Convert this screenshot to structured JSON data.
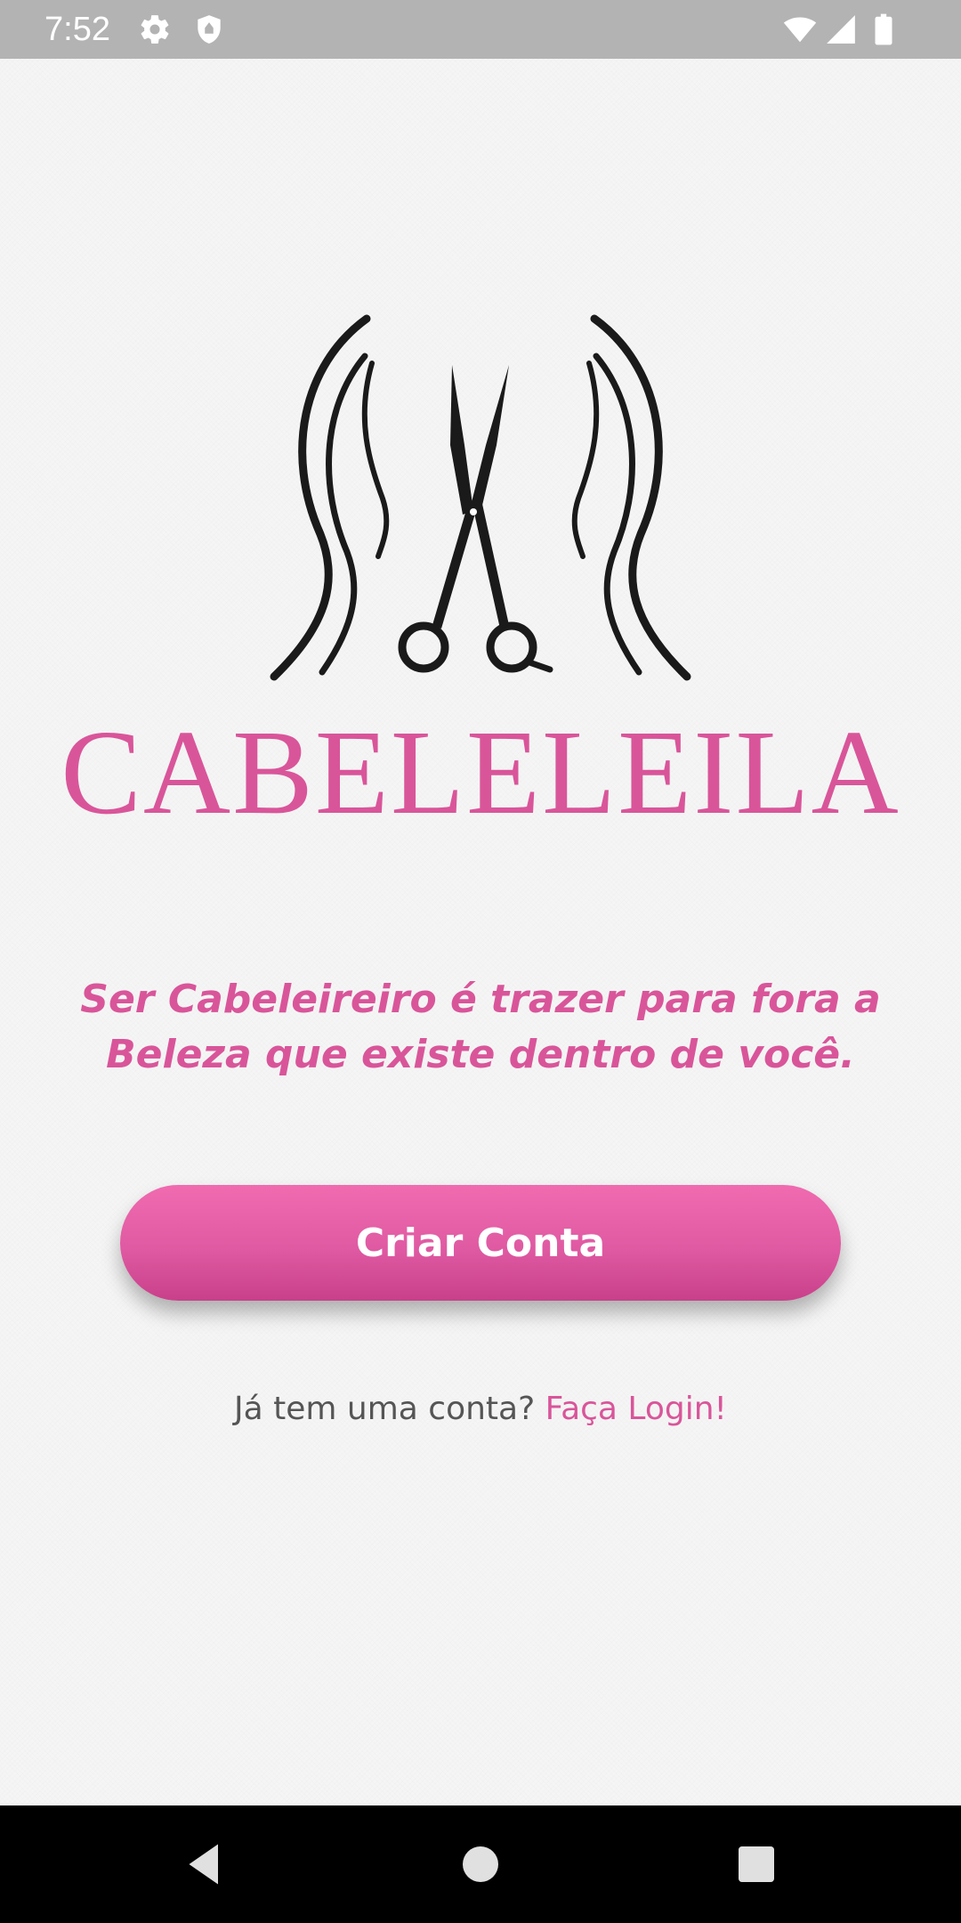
{
  "status_bar": {
    "time": "7:52",
    "icons": [
      "gear-icon",
      "shield-icon",
      "wifi-icon",
      "signal-icon",
      "battery-icon"
    ]
  },
  "logo": {
    "icon": "scissors-hair-icon",
    "brand_name": "CABELELEILA"
  },
  "tagline": {
    "line1": "Ser Cabeleireiro é trazer para fora a",
    "line2": "Beleza que existe dentro de você."
  },
  "create_account": {
    "label": "Criar Conta"
  },
  "login_prompt": {
    "question": "Já tem uma conta?",
    "link": "Faça Login!"
  },
  "nav_bar": {
    "icons": [
      "back-icon",
      "home-icon",
      "recents-icon"
    ]
  },
  "colors": {
    "brand_pink": "#d9559a",
    "button_gradient_top": "#f06bb0",
    "button_gradient_bottom": "#c8408a",
    "status_bar": "#b3b3b3",
    "nav_bar": "#000000",
    "background": "#f5f5f5"
  }
}
